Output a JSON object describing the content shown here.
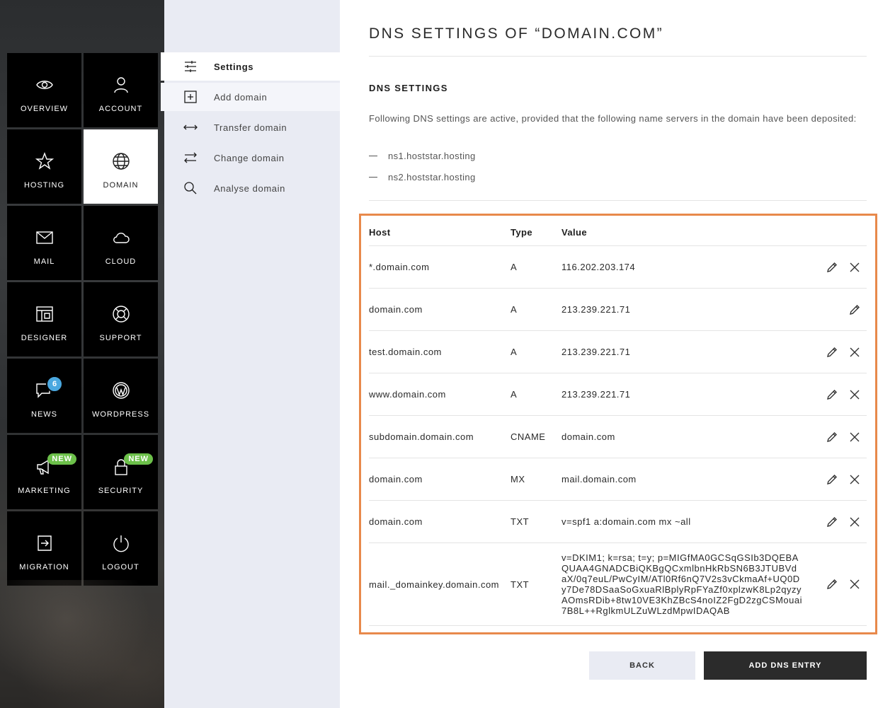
{
  "sidebar": {
    "tiles": [
      {
        "label": "OVERVIEW",
        "icon": "eye-icon"
      },
      {
        "label": "ACCOUNT",
        "icon": "user-icon"
      },
      {
        "label": "HOSTING",
        "icon": "star-icon"
      },
      {
        "label": "DOMAIN",
        "icon": "globe-icon",
        "active": true
      },
      {
        "label": "MAIL",
        "icon": "envelope-icon"
      },
      {
        "label": "CLOUD",
        "icon": "cloud-icon"
      },
      {
        "label": "DESIGNER",
        "icon": "layout-icon"
      },
      {
        "label": "SUPPORT",
        "icon": "lifebuoy-icon"
      },
      {
        "label": "NEWS",
        "icon": "chat-bubble-icon",
        "badge": "6"
      },
      {
        "label": "WORDPRESS",
        "icon": "wordpress-icon"
      },
      {
        "label": "MARKETING",
        "icon": "megaphone-icon",
        "badge": "NEW"
      },
      {
        "label": "SECURITY",
        "icon": "lock-icon",
        "badge": "NEW"
      },
      {
        "label": "MIGRATION",
        "icon": "migration-icon"
      },
      {
        "label": "LOGOUT",
        "icon": "power-icon"
      }
    ],
    "badge_colors": {
      "count": "#4aa8e0",
      "new": "#6cc04a"
    }
  },
  "subnav": {
    "items": [
      {
        "label": "Settings",
        "icon": "sliders-icon"
      },
      {
        "label": "Add domain",
        "icon": "plus-square-icon"
      },
      {
        "label": "Transfer domain",
        "icon": "double-arrow-icon"
      },
      {
        "label": "Change domain",
        "icon": "swap-arrows-icon"
      },
      {
        "label": "Analyse domain",
        "icon": "magnifier-icon"
      }
    ]
  },
  "main": {
    "title": "DNS SETTINGS OF “DOMAIN.COM”",
    "section_title": "DNS SETTINGS",
    "intro": "Following DNS settings are active, provided that the following name servers in the domain have been deposited:",
    "nameservers": [
      "ns1.hoststar.hosting",
      "ns2.hoststar.hosting"
    ]
  },
  "table": {
    "headers": {
      "host": "Host",
      "type": "Type",
      "value": "Value"
    },
    "rows": [
      {
        "host": "*.domain.com",
        "type": "A",
        "value": "116.202.203.174",
        "delete": true
      },
      {
        "host": "domain.com",
        "type": "A",
        "value": "213.239.221.71",
        "delete": false
      },
      {
        "host": "test.domain.com",
        "type": "A",
        "value": "213.239.221.71",
        "delete": true
      },
      {
        "host": "www.domain.com",
        "type": "A",
        "value": "213.239.221.71",
        "delete": true
      },
      {
        "host": "subdomain.domain.com",
        "type": "CNAME",
        "value": "domain.com",
        "delete": true
      },
      {
        "host": "domain.com",
        "type": "MX",
        "value": "mail.domain.com",
        "delete": true
      },
      {
        "host": "domain.com",
        "type": "TXT",
        "value": "v=spf1 a:domain.com mx ~all",
        "delete": true
      },
      {
        "host": "mail._domainkey.domain.com",
        "type": "TXT",
        "value": "v=DKIM1; k=rsa; t=y; p=MIGfMA0GCSqGSIb3DQEBAQUAA4GNADCBiQKBgQCxmlbnHkRbSN6B3JTUBVdaX/0q7euL/PwCyIM/ATl0Rf6nQ7V2s3vCkmaAf+UQ0Dy7De78DSaaSoGxuaRlBplyRpFYaZf0xplzwK8Lp2qyzyAOmsRDib+8tw10VE3KhZBcS4noIZ2FgD2zgCSMouai7B8L++RglkmULZuWLzdMpwIDAQAB",
        "delete": true,
        "tall": true
      }
    ],
    "frame_color": "#e8894b"
  },
  "buttons": {
    "back": "BACK",
    "add": "ADD DNS ENTRY"
  }
}
